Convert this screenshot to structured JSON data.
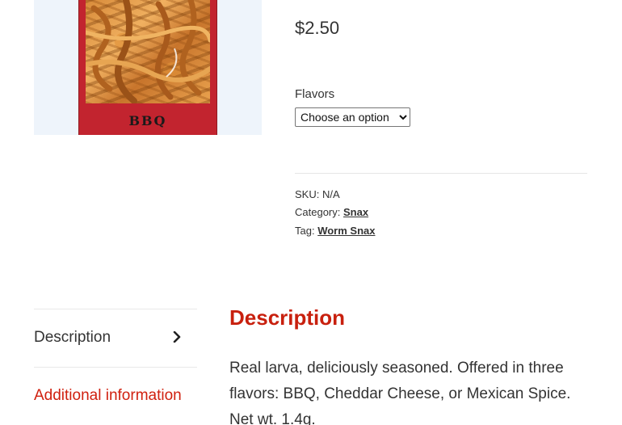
{
  "product": {
    "image_label": "BBQ",
    "price": "$2.50",
    "flavors_label": "Flavors",
    "flavors_select_value": "Choose an option",
    "sku_label": "SKU:",
    "sku_value": "N/A",
    "category_label": "Category:",
    "category_value": "Snax",
    "tag_label": "Tag:",
    "tag_value": "Worm Snax"
  },
  "tabs": [
    {
      "label": "Description",
      "icon": "chevron-right-icon",
      "active": false
    },
    {
      "label": "Additional information",
      "active": true
    }
  ],
  "panel": {
    "title": "Description",
    "body": "Real larva, deliciously seasoned. Offered in three flavors: BBQ, Cheddar Cheese, or Mexican Spice. Net wt. 1.4g."
  },
  "colors": {
    "accent": "#c8200e",
    "package_red": "#c2242f",
    "image_bg": "#eef4fb"
  }
}
